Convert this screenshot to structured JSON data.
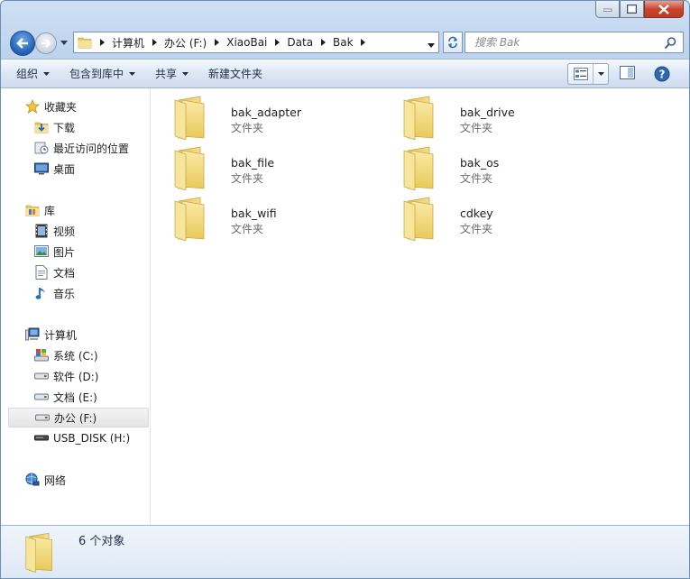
{
  "window": {
    "controls": {
      "minimize": "minimize",
      "maximize": "maximize",
      "close": "close"
    }
  },
  "navigation": {
    "breadcrumbs": [
      "计算机",
      "办公 (F:)",
      "XiaoBai",
      "Data",
      "Bak"
    ]
  },
  "search": {
    "placeholder": "搜索 Bak"
  },
  "toolbar": {
    "commands": [
      {
        "label": "组织",
        "has_dropdown": true
      },
      {
        "label": "包含到库中",
        "has_dropdown": true
      },
      {
        "label": "共享",
        "has_dropdown": true
      },
      {
        "label": "新建文件夹",
        "has_dropdown": false
      }
    ]
  },
  "sidebar": {
    "favorites": {
      "label": "收藏夹",
      "items": [
        {
          "label": "下载",
          "icon": "download-folder-icon"
        },
        {
          "label": "最近访问的位置",
          "icon": "recent-places-icon"
        },
        {
          "label": "桌面",
          "icon": "desktop-icon"
        }
      ]
    },
    "libraries": {
      "label": "库",
      "items": [
        {
          "label": "视频",
          "icon": "video-icon"
        },
        {
          "label": "图片",
          "icon": "pictures-icon"
        },
        {
          "label": "文档",
          "icon": "documents-icon"
        },
        {
          "label": "音乐",
          "icon": "music-icon"
        }
      ]
    },
    "computer": {
      "label": "计算机",
      "items": [
        {
          "label": "系统 (C:)",
          "icon": "system-drive-icon"
        },
        {
          "label": "软件 (D:)",
          "icon": "drive-icon"
        },
        {
          "label": "文档 (E:)",
          "icon": "drive-icon"
        },
        {
          "label": "办公 (F:)",
          "icon": "drive-icon",
          "selected": true
        },
        {
          "label": "USB_DISK (H:)",
          "icon": "usb-drive-icon"
        }
      ]
    },
    "network": {
      "label": "网络"
    }
  },
  "content": {
    "items": [
      {
        "name": "bak_adapter",
        "type": "文件夹"
      },
      {
        "name": "bak_drive",
        "type": "文件夹"
      },
      {
        "name": "bak_file",
        "type": "文件夹"
      },
      {
        "name": "bak_os",
        "type": "文件夹"
      },
      {
        "name": "bak_wifi",
        "type": "文件夹"
      },
      {
        "name": "cdkey",
        "type": "文件夹"
      }
    ]
  },
  "details": {
    "count_text": "6 个对象"
  },
  "colors": {
    "folder_yellow": "#f2d77a",
    "accent_blue": "#1f5fb4",
    "frame": "#bcd2ec"
  }
}
